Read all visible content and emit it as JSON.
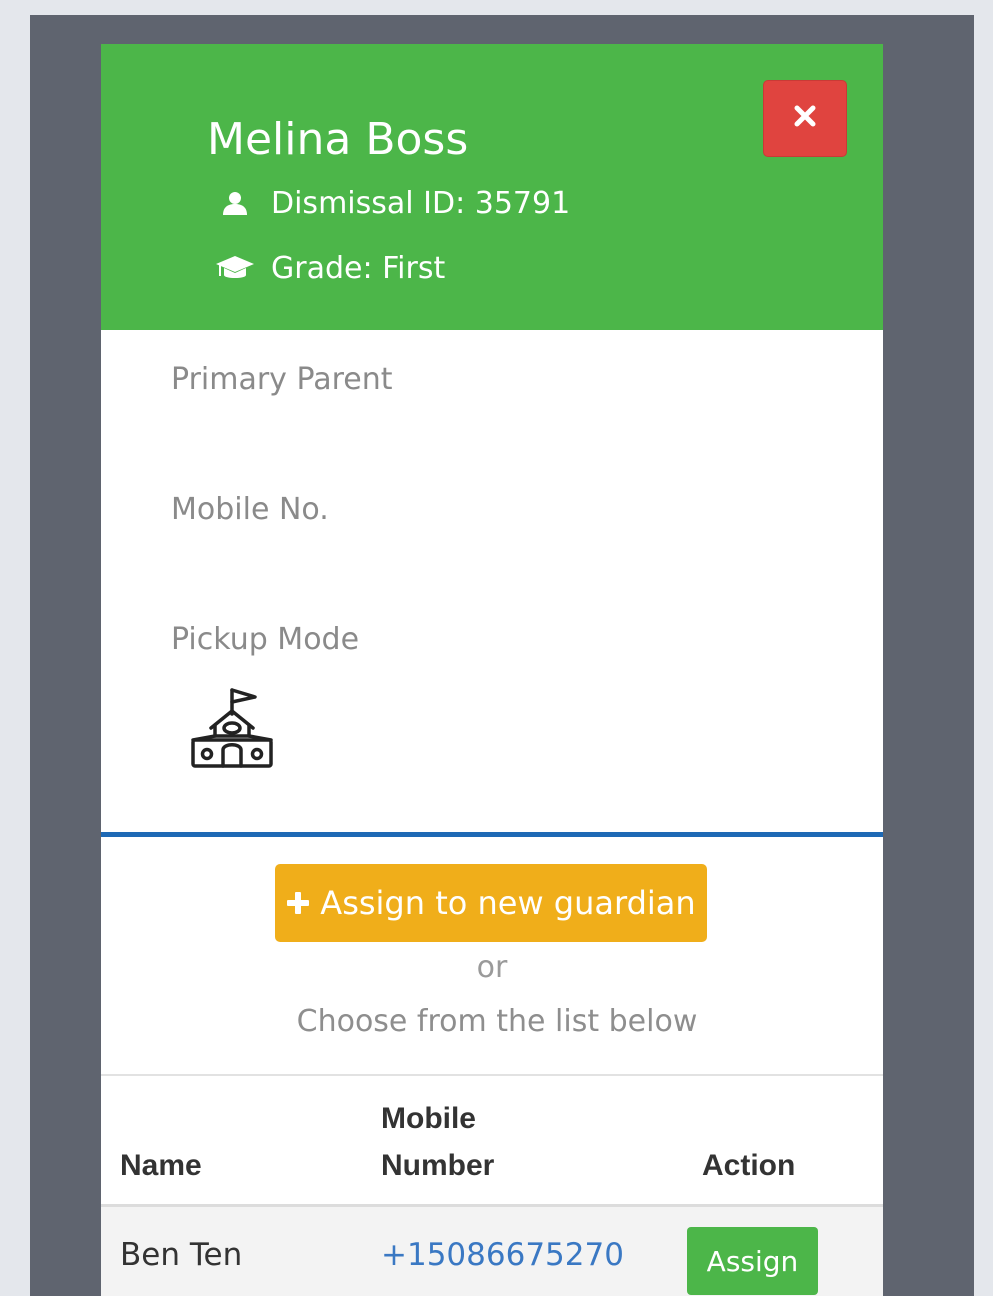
{
  "student": {
    "name": "Melina Boss",
    "dismissal_id": "Dismissal ID: 35791",
    "grade": "Grade: First",
    "id_icon": "user-icon",
    "grade_icon": "graduation-cap-icon"
  },
  "header": {
    "close_icon": "close-icon"
  },
  "fields": {
    "primary_parent_label": "Primary Parent",
    "mobile_label": "Mobile No.",
    "pickup_mode_label": "Pickup Mode",
    "pickup_mode_icon": "school-building-icon"
  },
  "actions": {
    "assign_new_label": "Assign to new guardian",
    "assign_new_icon": "plus-icon",
    "or_text": "or",
    "choose_text": "Choose from the list below"
  },
  "table": {
    "columns": [
      "Name",
      "Mobile Number",
      "Action"
    ],
    "rows": [
      {
        "name": "Ben Ten",
        "mobile": "+15086675270",
        "action": "Assign"
      }
    ]
  },
  "colors": {
    "header_bg": "#4cb649",
    "close_button": "#e0443f",
    "divider": "#1e69b5",
    "assign_new_button": "#f0ae1a",
    "assign_button": "#4cb649",
    "link": "#3a78c3"
  }
}
